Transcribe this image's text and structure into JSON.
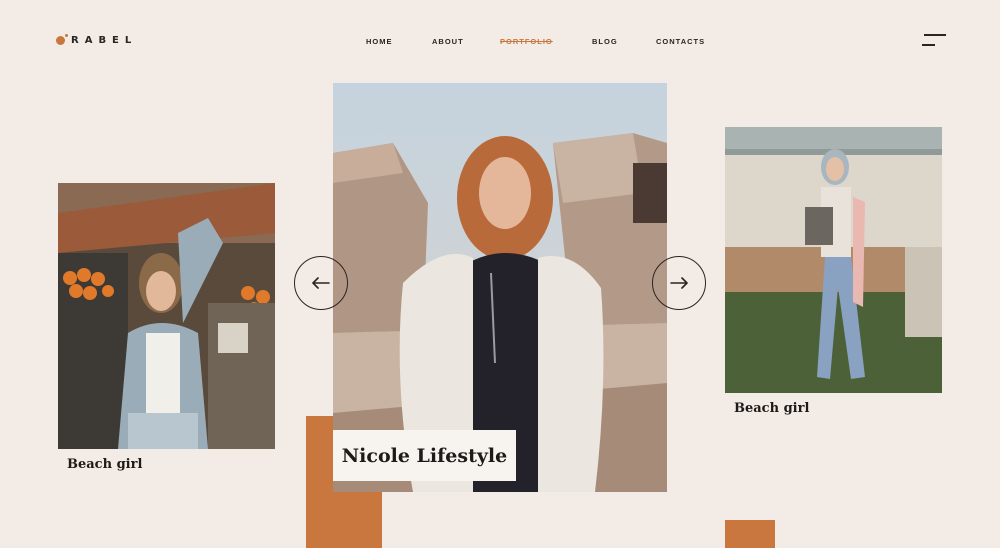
{
  "brand": {
    "logo_text": "RABEL",
    "accent": "#c9773e"
  },
  "nav": {
    "items": [
      "HOME",
      "ABOUT",
      "PORTFOLIO",
      "BLOG",
      "CONTACTS"
    ],
    "active": "PORTFOLIO"
  },
  "slides": {
    "left": {
      "caption": "Beach girl"
    },
    "center": {
      "title": "Nicole Lifestyle"
    },
    "right": {
      "caption": "Beach girl"
    }
  },
  "controls": {
    "prev_icon": "arrow-left-icon",
    "next_icon": "arrow-right-icon",
    "menu_icon": "hamburger-menu-icon"
  },
  "colors": {
    "background": "#f2ebe6",
    "accent": "#c9773e",
    "text": "#2a2522"
  }
}
